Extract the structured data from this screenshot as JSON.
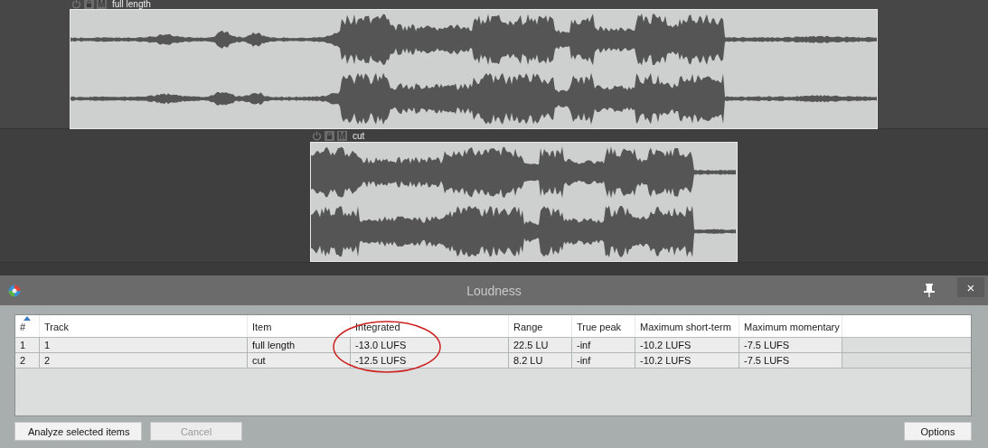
{
  "tracks": [
    {
      "name": "full length",
      "mute_label": "M"
    },
    {
      "name": "cut",
      "mute_label": "M"
    }
  ],
  "dialog": {
    "title": "Loudness",
    "close_label": "×",
    "table": {
      "columns": [
        {
          "label": "#",
          "sorted": true
        },
        {
          "label": "Track",
          "sorted": false
        },
        {
          "label": "Item",
          "sorted": false
        },
        {
          "label": "Integrated",
          "sorted": false
        },
        {
          "label": "Range",
          "sorted": false
        },
        {
          "label": "True peak",
          "sorted": false
        },
        {
          "label": "Maximum short-term",
          "sorted": false
        },
        {
          "label": "Maximum momentary",
          "sorted": false
        }
      ],
      "rows": [
        [
          "1",
          "1",
          "full length",
          "-13.0 LUFS",
          "22.5 LU",
          "-inf",
          "-10.2 LUFS",
          "-7.5 LUFS"
        ],
        [
          "2",
          "2",
          "cut",
          "-12.5 LUFS",
          "8.2 LU",
          "-inf",
          "-10.2 LUFS",
          "-7.5 LUFS"
        ]
      ]
    },
    "buttons": [
      {
        "label": "Analyze selected items",
        "disabled": false,
        "kind": "left"
      },
      {
        "label": "Cancel",
        "disabled": true,
        "kind": "left"
      },
      {
        "label": "Options",
        "disabled": false,
        "kind": "right"
      }
    ]
  }
}
